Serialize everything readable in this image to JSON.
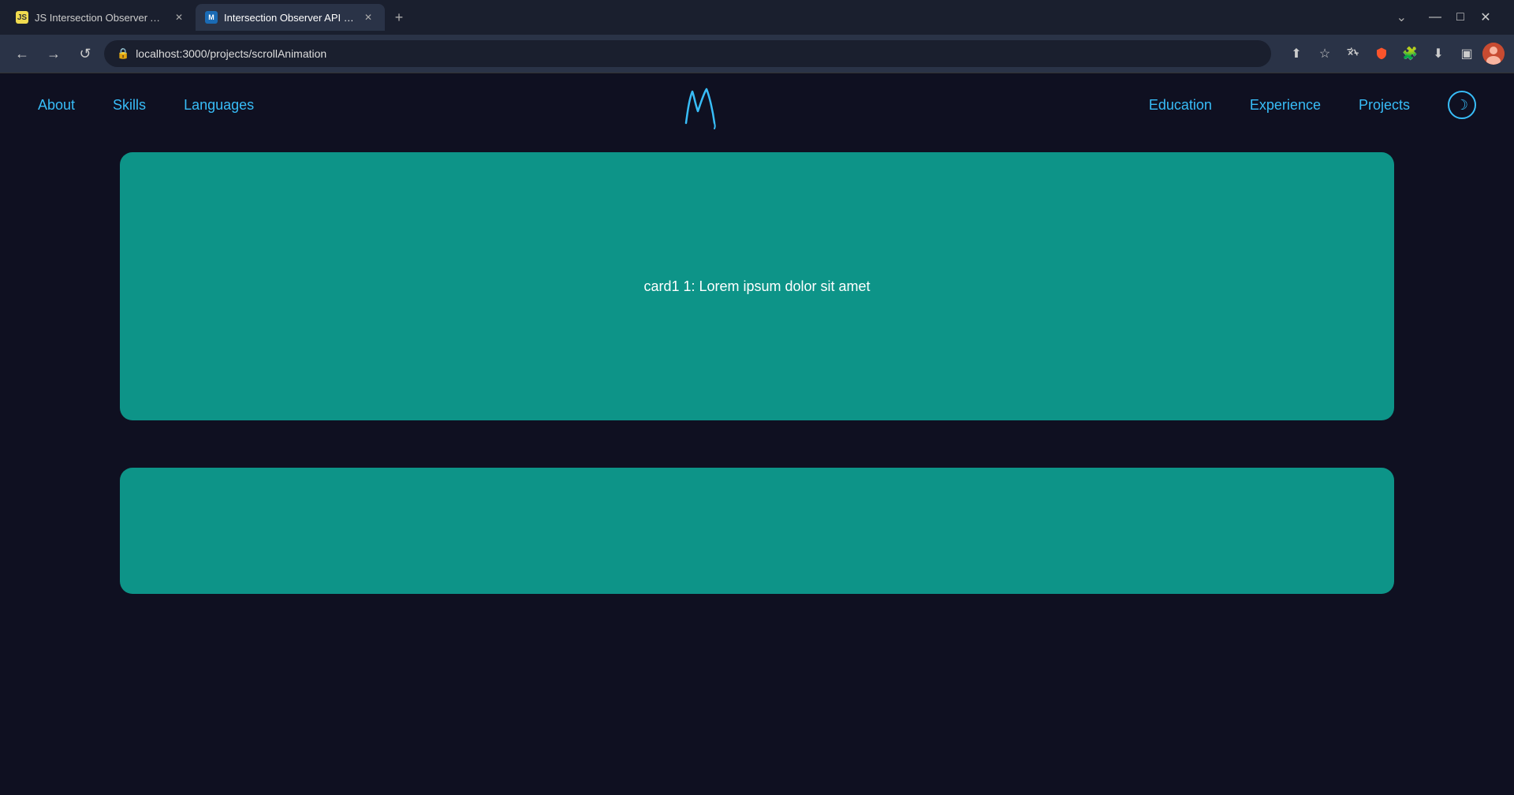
{
  "browser": {
    "tabs": [
      {
        "id": "tab1",
        "favicon_type": "js",
        "favicon_label": "JS",
        "label": "JS Intersection Observer API",
        "active": false
      },
      {
        "id": "tab2",
        "favicon_type": "mdn",
        "favicon_label": "M",
        "label": "Intersection Observer API - Web",
        "active": true
      }
    ],
    "new_tab_icon": "+",
    "tab_expand_icon": "⌄",
    "window_controls": {
      "minimize": "—",
      "maximize": "□",
      "close": "✕"
    },
    "nav": {
      "back": "←",
      "forward": "→",
      "refresh": "↺"
    },
    "address": "localhost:3000/projects/scrollAnimation",
    "toolbar_icons": [
      "share",
      "star",
      "translate",
      "brave",
      "extension",
      "download",
      "split",
      "profile"
    ]
  },
  "navbar": {
    "links_left": [
      {
        "id": "about",
        "label": "About"
      },
      {
        "id": "skills",
        "label": "Skills"
      },
      {
        "id": "languages",
        "label": "Languages"
      }
    ],
    "links_right": [
      {
        "id": "education",
        "label": "Education"
      },
      {
        "id": "experience",
        "label": "Experience"
      },
      {
        "id": "projects",
        "label": "Projects"
      }
    ],
    "theme_toggle_icon": "☽"
  },
  "cards": [
    {
      "id": "card1",
      "text": "card1 1: Lorem ipsum dolor sit amet"
    },
    {
      "id": "card2",
      "text": ""
    }
  ],
  "colors": {
    "background": "#0f1021",
    "nav_link": "#38bdf8",
    "card_bg": "#0d9488",
    "card_text": "#ffffff"
  }
}
